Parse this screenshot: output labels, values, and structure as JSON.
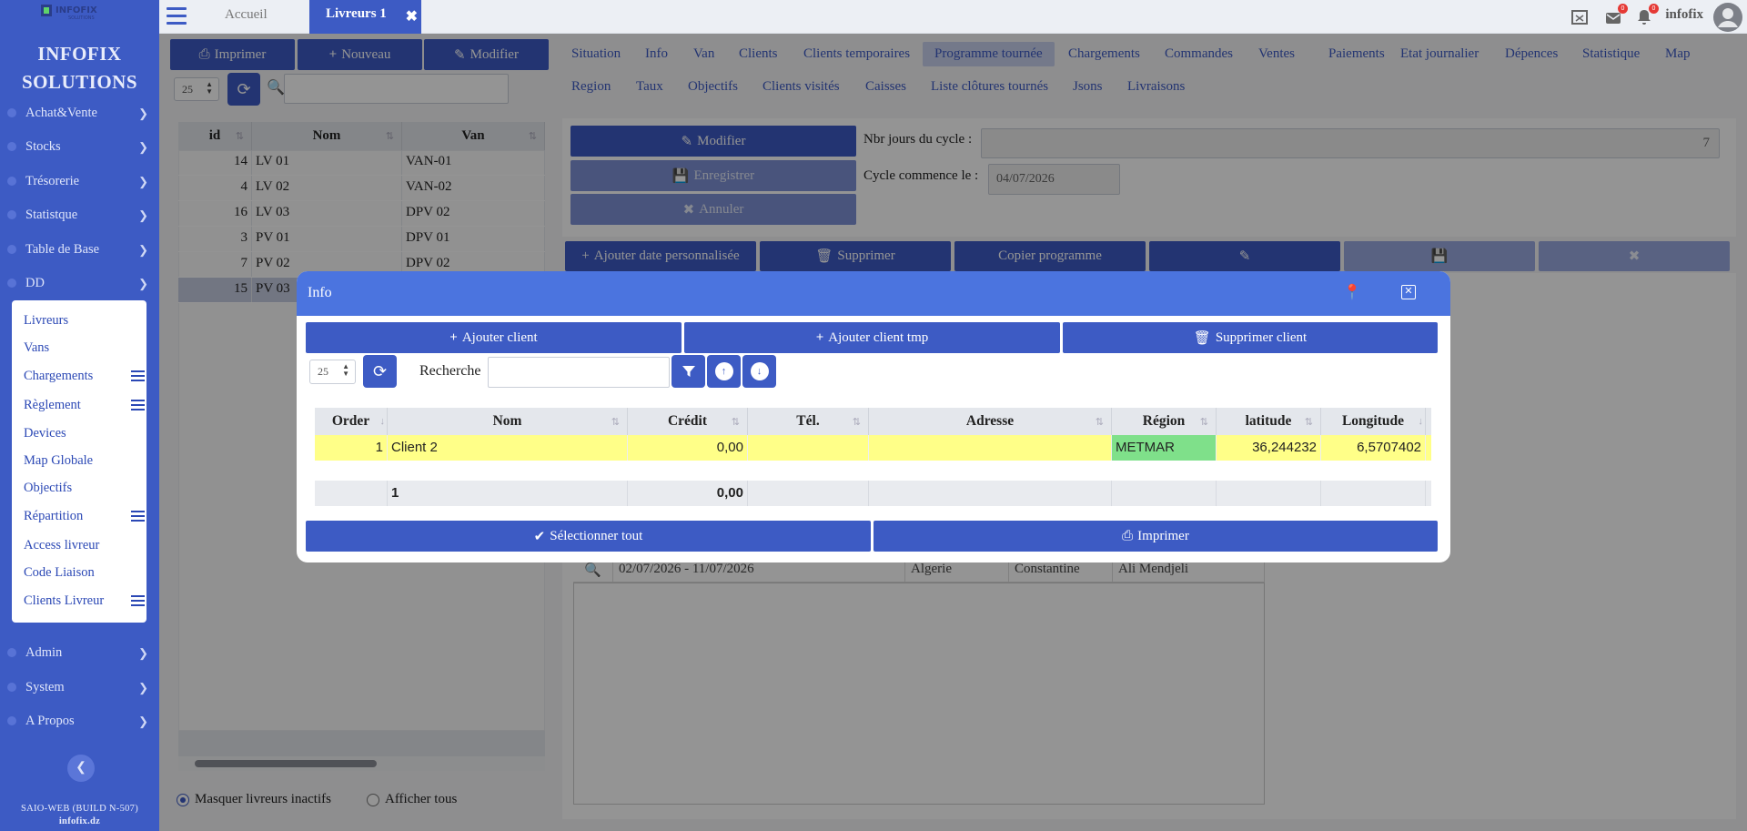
{
  "app": {
    "logo_text": "INFOFIX SOLUTIONS",
    "brand": "INFOFIX SOLUTIONS",
    "build": "SAIO-WEB (BUILD N-507)",
    "site": "infofix.dz"
  },
  "sidebar": {
    "items": [
      {
        "label": "Achat&Vente"
      },
      {
        "label": "Stocks"
      },
      {
        "label": "Trésorerie"
      },
      {
        "label": "Statistque"
      },
      {
        "label": "Table de Base"
      },
      {
        "label": "DD"
      }
    ],
    "sub_items": [
      {
        "label": "Livreurs"
      },
      {
        "label": "Vans"
      },
      {
        "label": "Chargements"
      },
      {
        "label": "Règlement"
      },
      {
        "label": "Devices"
      },
      {
        "label": "Map Globale"
      },
      {
        "label": "Objectifs"
      },
      {
        "label": "Répartition"
      },
      {
        "label": "Access livreur"
      },
      {
        "label": "Code Liaison"
      },
      {
        "label": "Clients Livreur"
      }
    ],
    "bottom_items": [
      {
        "label": "Admin"
      },
      {
        "label": "System"
      },
      {
        "label": "A Propos"
      }
    ]
  },
  "topbar": {
    "home_tab": "Accueil",
    "active_tab": "Livreurs 1",
    "badge1": "0",
    "badge2": "0",
    "user": "infofix"
  },
  "left": {
    "print": "Imprimer",
    "new": "Nouveau",
    "edit": "Modifier",
    "page_size": "25",
    "columns": [
      "id",
      "Nom",
      "Van"
    ],
    "rows": [
      {
        "id": "14",
        "nom": "LV 01",
        "van": "VAN-01"
      },
      {
        "id": "4",
        "nom": "LV 02",
        "van": "VAN-02"
      },
      {
        "id": "16",
        "nom": "LV 03",
        "van": "DPV 02"
      },
      {
        "id": "3",
        "nom": "PV 01",
        "van": "DPV 01"
      },
      {
        "id": "7",
        "nom": "PV 02",
        "van": "DPV 02"
      },
      {
        "id": "15",
        "nom": "PV 03",
        "van": ""
      }
    ],
    "radio_inactive": "Masquer livreurs inactifs",
    "radio_all": "Afficher tous"
  },
  "tabs_row1": [
    "Situation",
    "Info",
    "Van",
    "Clients",
    "Clients temporaires",
    "Programme tournée",
    "Chargements",
    "Commandes",
    "Ventes",
    "Paiements",
    "Etat journalier",
    "Dépences",
    "Statistique",
    "Map"
  ],
  "tabs_row2": [
    "Region",
    "Taux",
    "Objectifs",
    "Clients visités",
    "Caisses",
    "Liste clôtures tournés",
    "Jsons",
    "Livraisons"
  ],
  "programme": {
    "modify": "Modifier",
    "save": "Enregistrer",
    "cancel": "Annuler",
    "cycle_days_label": "Nbr jours du cycle :",
    "cycle_days": "7",
    "cycle_start_label": "Cycle commence le :",
    "cycle_start": "04/07/2026",
    "add_date": "Ajouter date personnalisée",
    "delete": "Supprimer",
    "copy": "Copier programme",
    "row": {
      "period": "02/07/2026 - 11/07/2026",
      "country": "Algerie",
      "city": "Constantine",
      "zone": "Ali Mendjeli"
    }
  },
  "dialog": {
    "title": "Info",
    "add_client": "Ajouter client",
    "add_client_tmp": "Ajouter client tmp",
    "delete_client": "Supprimer client",
    "page_size": "25",
    "search_label": "Recherche",
    "columns": [
      "Order",
      "Nom",
      "Crédit",
      "Tél.",
      "Adresse",
      "Région",
      "latitude",
      "Longitude"
    ],
    "rows": [
      {
        "order": "1",
        "nom": "Client 2",
        "credit": "0,00",
        "tel": "",
        "adresse": "",
        "region": "METMAR",
        "lat": "36,244232",
        "lng": "6,5707402"
      }
    ],
    "footer": {
      "count": "1",
      "credit_total": "0,00"
    },
    "select_all": "Sélectionner tout",
    "print": "Imprimer"
  },
  "colors": {
    "primary": "#3d5bc4",
    "dialog_header": "#4b74df",
    "row_highlight": "#ffff88",
    "region_cell": "#7fe08a"
  }
}
